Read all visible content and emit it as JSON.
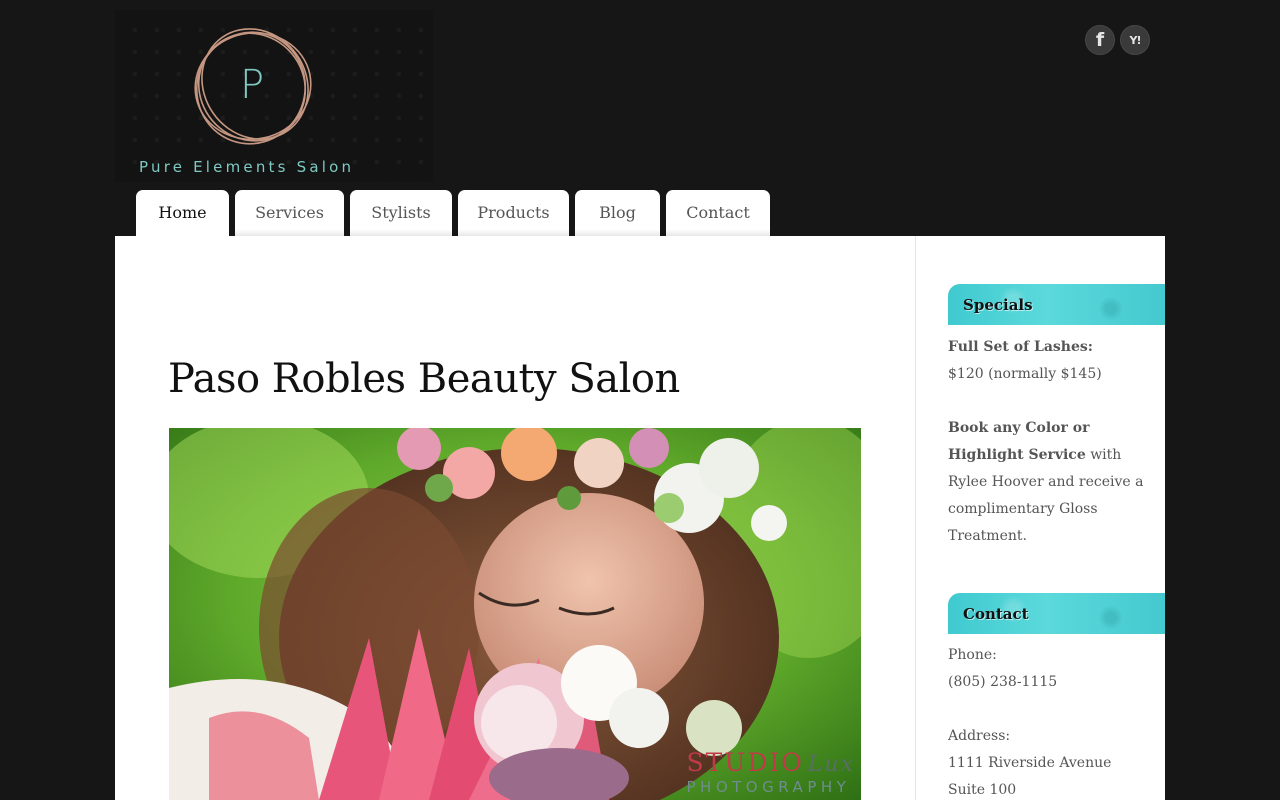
{
  "header": {
    "logo_letter": "P",
    "logo_text": "Pure Elements Salon",
    "social": [
      {
        "name": "facebook",
        "glyph": "f"
      },
      {
        "name": "yelp",
        "glyph": "Y!"
      }
    ]
  },
  "nav": {
    "tabs": [
      {
        "label": "Home",
        "active": true
      },
      {
        "label": "Services",
        "active": false
      },
      {
        "label": "Stylists",
        "active": false
      },
      {
        "label": "Products",
        "active": false
      },
      {
        "label": "Blog",
        "active": false
      },
      {
        "label": "Contact",
        "active": false
      }
    ]
  },
  "main": {
    "title": "Paso Robles Beauty Salon",
    "hero_watermark": {
      "line1": "STUDIO",
      "line1_script": "Lux",
      "line2": "PHOTOGRAPHY"
    }
  },
  "sidebar": {
    "specials": {
      "heading": "Specials",
      "item1_title": "Full Set of Lashes:",
      "item1_price": "$120 (normally $145)",
      "item2_title_a": "Book any Color or",
      "item2_title_b": "Highlight Service",
      "item2_rest_a": " with",
      "item2_rest_b": "Rylee Hoover and receive a",
      "item2_rest_c": "complimentary Gloss",
      "item2_rest_d": "Treatment."
    },
    "contact": {
      "heading": "Contact",
      "phone_label": "Phone:",
      "phone": "(805) 238-1115",
      "address_label": "Address:",
      "address_line1": "1111 Riverside Avenue",
      "address_line2": "Suite 100"
    }
  },
  "colors": {
    "background": "#161616",
    "accent_teal": "#45d0d4",
    "logo_text": "#7fc9c2",
    "logo_ring": "#d9a68f"
  }
}
